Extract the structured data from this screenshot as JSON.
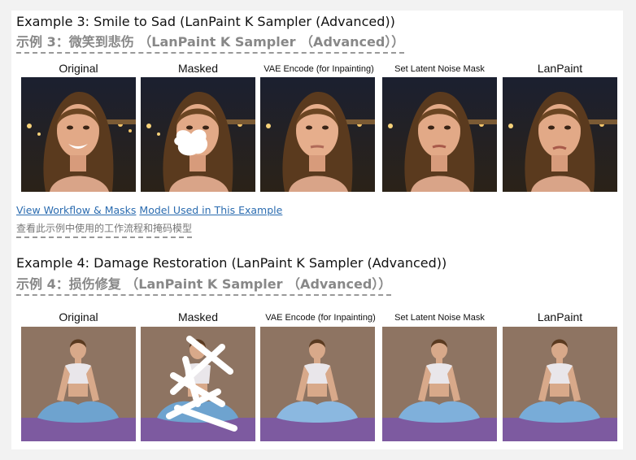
{
  "example3": {
    "title": "Example 3: Smile to Sad (LanPaint K Sampler (Advanced))",
    "title_zh": "示例 3：微笑到悲伤 （LanPaint K Sampler （Advanced））",
    "captions": [
      "Original",
      "Masked",
      "VAE Encode (for Inpainting)",
      "Set Latent Noise Mask",
      "LanPaint"
    ]
  },
  "links": {
    "workflow": "View Workflow & Masks",
    "model": "Model Used in This Example",
    "note_zh": "查看此示例中使用的工作流程和掩码模型"
  },
  "example4": {
    "title": "Example 4: Damage Restoration (LanPaint K Sampler (Advanced))",
    "title_zh": "示例 4：损伤修复 （LanPaint K Sampler （Advanced））",
    "captions": [
      "Original",
      "Masked",
      "VAE Encode (for Inpainting)",
      "Set Latent Noise Mask",
      "LanPaint"
    ]
  }
}
